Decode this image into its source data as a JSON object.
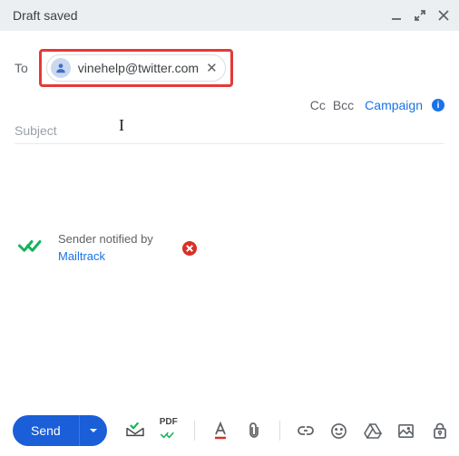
{
  "header": {
    "title": "Draft saved"
  },
  "to": {
    "label": "To",
    "chip": {
      "email": "vinehelp@twitter.com"
    }
  },
  "links": {
    "cc": "Cc",
    "bcc": "Bcc",
    "campaign": "Campaign",
    "info": "i"
  },
  "subject": {
    "placeholder": "Subject",
    "value": ""
  },
  "notification": {
    "text": "Sender notified by",
    "link": "Mailtrack"
  },
  "toolbar": {
    "send": "Send",
    "pdf": "PDF"
  }
}
